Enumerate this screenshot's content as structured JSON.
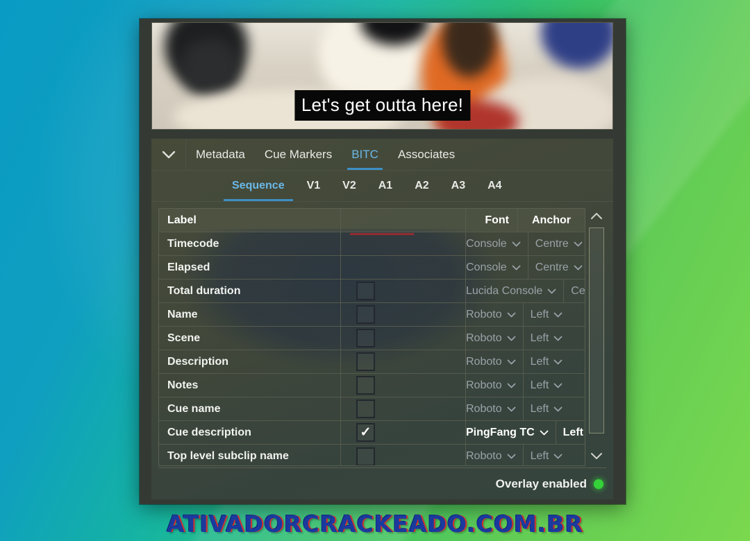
{
  "background": {
    "gradient_from": "#0a9bc4",
    "gradient_to": "#7ad84e"
  },
  "video": {
    "caption": "Let's get outta here!"
  },
  "panel": {
    "collapse_icon": "chevron-down-icon",
    "primary_tabs": [
      {
        "label": "Metadata",
        "active": false
      },
      {
        "label": "Cue Markers",
        "active": false
      },
      {
        "label": "BITC",
        "active": true
      },
      {
        "label": "Associates",
        "active": false
      }
    ],
    "secondary_tabs": [
      {
        "label": "Sequence",
        "active": true
      },
      {
        "label": "V1",
        "active": false
      },
      {
        "label": "V2",
        "active": false
      },
      {
        "label": "A1",
        "active": false
      },
      {
        "label": "A2",
        "active": false
      },
      {
        "label": "A3",
        "active": false
      },
      {
        "label": "A4",
        "active": false
      }
    ],
    "accent_color": "#6ab8e8"
  },
  "table": {
    "headers": {
      "label": "Label",
      "font": "Font",
      "anchor": "Anchor"
    },
    "rows": [
      {
        "label": "Timecode",
        "has_checkbox": false,
        "checked": false,
        "font": "Console",
        "anchor": "Centre",
        "enabled": false
      },
      {
        "label": "Elapsed",
        "has_checkbox": false,
        "checked": false,
        "font": "Console",
        "anchor": "Centre",
        "enabled": false
      },
      {
        "label": "Total duration",
        "has_checkbox": true,
        "checked": false,
        "font": "Lucida Console",
        "anchor": "Centre",
        "enabled": false
      },
      {
        "label": "Name",
        "has_checkbox": true,
        "checked": false,
        "font": "Roboto",
        "anchor": "Left",
        "enabled": false
      },
      {
        "label": "Scene",
        "has_checkbox": true,
        "checked": false,
        "font": "Roboto",
        "anchor": "Left",
        "enabled": false
      },
      {
        "label": "Description",
        "has_checkbox": true,
        "checked": false,
        "font": "Roboto",
        "anchor": "Left",
        "enabled": false
      },
      {
        "label": "Notes",
        "has_checkbox": true,
        "checked": false,
        "font": "Roboto",
        "anchor": "Left",
        "enabled": false
      },
      {
        "label": "Cue name",
        "has_checkbox": true,
        "checked": false,
        "font": "Roboto",
        "anchor": "Left",
        "enabled": false
      },
      {
        "label": "Cue description",
        "has_checkbox": true,
        "checked": true,
        "font": "PingFang TC",
        "anchor": "Left",
        "enabled": true
      },
      {
        "label": "Top level subclip name",
        "has_checkbox": true,
        "checked": false,
        "font": "Roboto",
        "anchor": "Left",
        "enabled": false
      }
    ],
    "checkmark_glyph": "✓",
    "dropdown_icon": "chevron-down-icon"
  },
  "scrollbar": {
    "up_icon": "chevron-up-icon",
    "down_icon": "chevron-down-icon"
  },
  "status": {
    "text": "Overlay enabled",
    "indicator_color": "#35d23a"
  },
  "watermark": {
    "text": "ativadorcrackeado.com.br"
  }
}
